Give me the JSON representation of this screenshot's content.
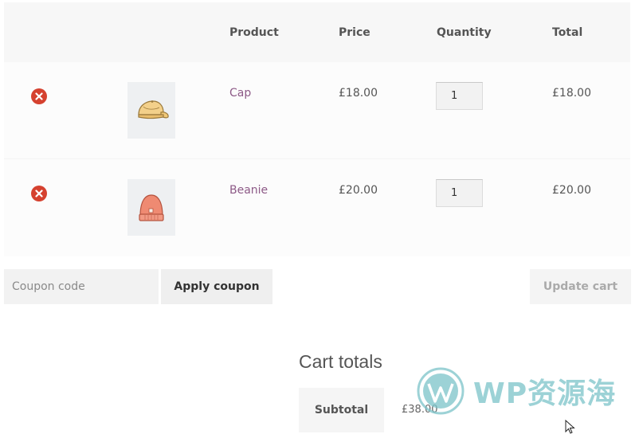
{
  "cart": {
    "headers": {
      "product": "Product",
      "price": "Price",
      "quantity": "Quantity",
      "total": "Total"
    },
    "items": [
      {
        "name": "Cap",
        "price": "£18.00",
        "quantity": "1",
        "total": "£18.00",
        "thumbnail_icon": "cap-icon",
        "thumbnail_color": "#f3d08a"
      },
      {
        "name": "Beanie",
        "price": "£20.00",
        "quantity": "1",
        "total": "£20.00",
        "thumbnail_icon": "beanie-icon",
        "thumbnail_color": "#ef8a72"
      }
    ],
    "remove_icon": "remove-circle-icon",
    "remove_color": "#d5412f"
  },
  "actions": {
    "coupon_placeholder": "Coupon code",
    "apply_coupon_label": "Apply coupon",
    "update_cart_label": "Update cart"
  },
  "totals": {
    "title": "Cart totals",
    "subtotal_label": "Subtotal",
    "subtotal_value": "£38.00"
  },
  "watermark": {
    "text": "WP资源海",
    "color": "#7cc3c9"
  },
  "colors": {
    "link": "#8d5a87",
    "header_bg": "#f7f7f7",
    "button_bg": "#efefef"
  }
}
